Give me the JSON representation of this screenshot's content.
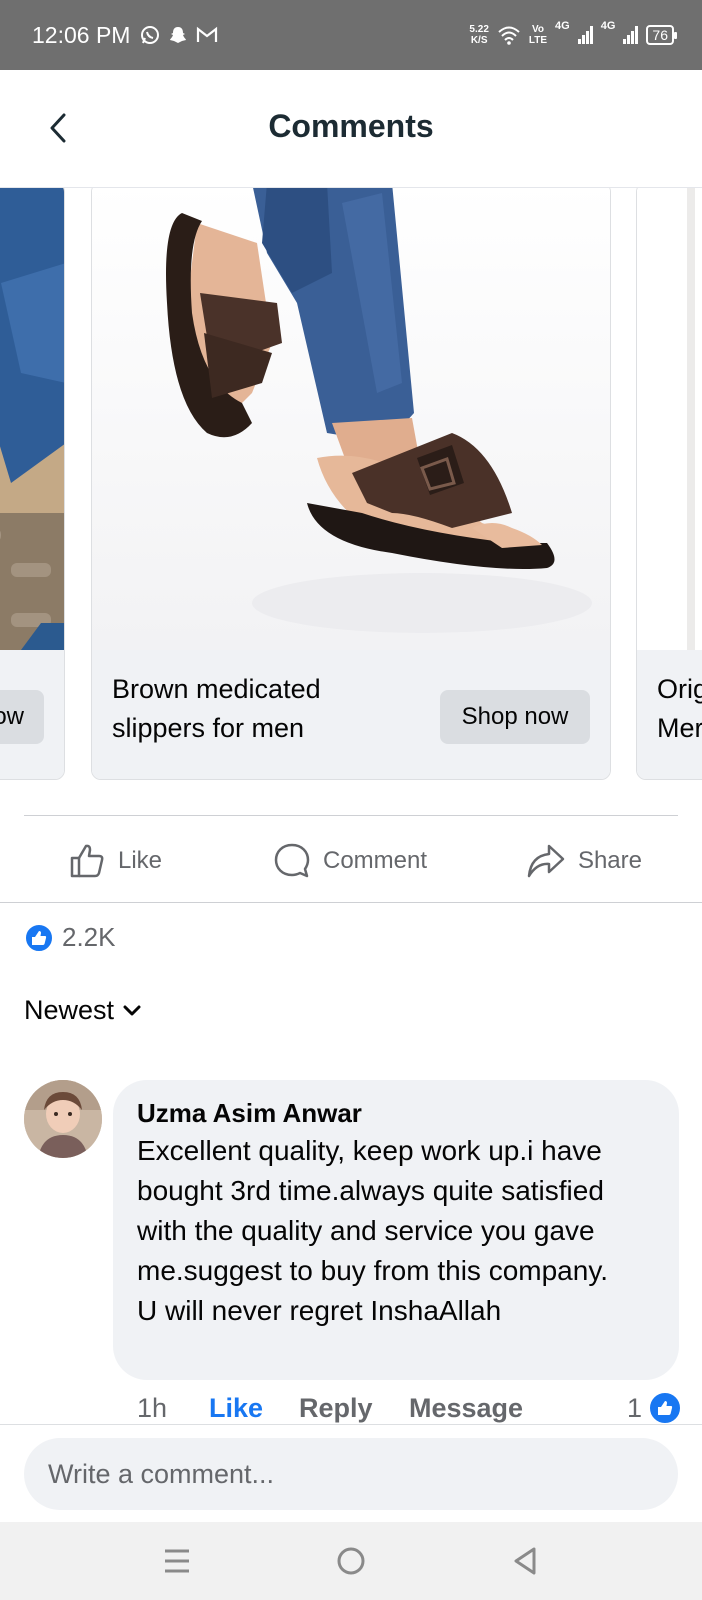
{
  "status_bar": {
    "time": "12:06 PM",
    "speed_value": "5.22",
    "speed_unit": "K/S",
    "volte_top": "Vo",
    "volte_bottom": "LTE",
    "network1": "4G",
    "network2": "4G",
    "battery": "76"
  },
  "header": {
    "title": "Comments"
  },
  "carousel": {
    "left_card": {
      "title": "",
      "button": "ow"
    },
    "main_card": {
      "title": "Brown medicated slippers for men",
      "button": "Shop now"
    },
    "right_card": {
      "title": "Orig\nMer",
      "button": ""
    }
  },
  "actions": {
    "like": "Like",
    "comment": "Comment",
    "share": "Share"
  },
  "reactions": {
    "count": "2.2K"
  },
  "sort": {
    "label": "Newest"
  },
  "comment": {
    "author": "Uzma Asim Anwar",
    "text": "Excellent quality, keep work up.i have bought 3rd time.always quite satisfied with the quality and service you gave me.suggest to buy from this company.\nU will never regret InshaAllah",
    "time": "1h",
    "like_label": "Like",
    "reply_label": "Reply",
    "message_label": "Message",
    "reaction_count": "1"
  },
  "composer": {
    "placeholder": "Write a comment..."
  },
  "colors": {
    "accent": "#1877f2",
    "status_bar": "#6f6f6f",
    "secondary_text": "#65676b",
    "bubble": "#f0f2f5"
  }
}
